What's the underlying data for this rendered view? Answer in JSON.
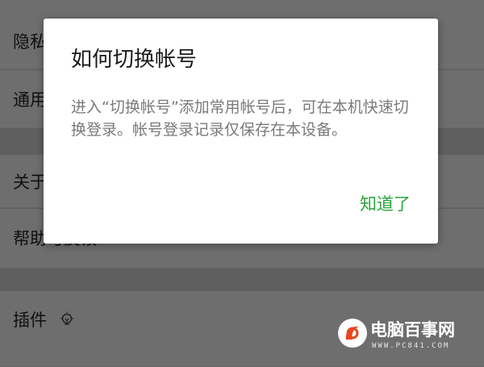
{
  "settings": {
    "items": [
      {
        "label": "隐私"
      },
      {
        "label": "通用"
      },
      {
        "label": "关于"
      },
      {
        "label": "帮助与反馈"
      },
      {
        "label": "插件"
      }
    ]
  },
  "dialog": {
    "title": "如何切换帐号",
    "message": "进入“切换帐号”添加常用帐号后，可在本机快速切换登录。帐号登录记录仅保存在本设备。",
    "confirm_label": "知道了"
  },
  "watermark": {
    "name": "电脑百事网",
    "url": "WWW.PC841.COM"
  },
  "colors": {
    "accent": "#2aa33a",
    "overlay": "#5f5f5f",
    "dialog_bg": "#ffffff"
  }
}
